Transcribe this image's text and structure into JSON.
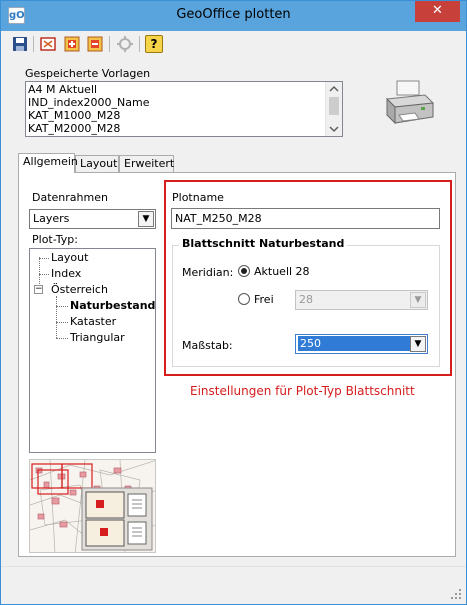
{
  "window": {
    "title": "GeoOffice plotten",
    "app_icon_text": "gO",
    "close_symbol": "✕"
  },
  "toolbar": {
    "icons": [
      "save-icon",
      "plot-frame-icon",
      "add-plot-icon",
      "remove-plot-icon",
      "settings-tool-icon",
      "help-icon"
    ],
    "help_label": "?"
  },
  "templates": {
    "label": "Gespeicherte Vorlagen",
    "items": [
      "A4 M Aktuell",
      "IND_index2000_Name",
      "KAT_M1000_M28",
      "KAT_M2000_M28"
    ]
  },
  "tabs": [
    "Allgemein",
    "Layout",
    "Erweitert"
  ],
  "left": {
    "frame_label": "Datenrahmen",
    "frame_value": "Layers",
    "plot_type_label": "Plot-Typ:",
    "tree": {
      "layout": "Layout",
      "index": "Index",
      "oesterreich": "Österreich",
      "naturbestand": "Naturbestand",
      "kataster": "Kataster",
      "triangular": "Triangular",
      "collapse_symbol": "−"
    }
  },
  "right": {
    "plotname_label": "Plotname",
    "plotname_value": "NAT_M250_M28",
    "section_title": "Blattschnitt Naturbestand",
    "meridian_label": "Meridian:",
    "option_current": "Aktuell 28",
    "option_free": "Frei",
    "free_value": "28",
    "scale_label": "Maßstab:",
    "scale_value": "250"
  },
  "note": "Einstellungen für Plot-Typ Blattschnitt",
  "colors": {
    "title_bar": "#5aa4dd",
    "close_button": "#c7413a",
    "highlight_red": "#d61c1c",
    "selection_blue": "#2f7bd6"
  }
}
